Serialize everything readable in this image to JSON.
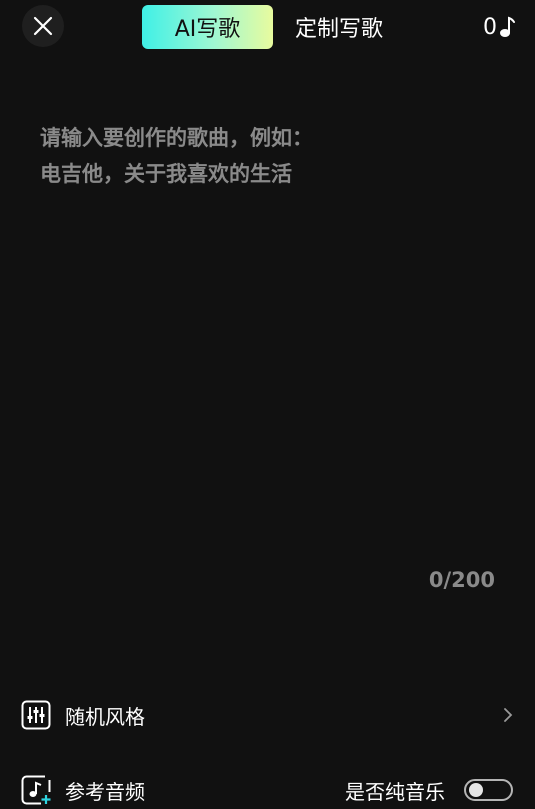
{
  "header": {
    "tab_ai": "AI写歌",
    "tab_custom": "定制写歌",
    "credits_count": "0"
  },
  "prompt": {
    "placeholder": "请输入要创作的歌曲，例如：\n电吉他，关于我喜欢的生活",
    "value": ""
  },
  "counter": "0/200",
  "style_row": {
    "label": "随机风格"
  },
  "reference_row": {
    "label": "参考音频",
    "pure_music_label": "是否纯音乐",
    "pure_music_on": false
  },
  "colors": {
    "background": "#111111",
    "accent_gradient": [
      "#3ff0e6",
      "#9ff7d2",
      "#e8fb9e"
    ],
    "muted_text": "#8a8a8a",
    "icon_accent": "#2fd4e0"
  }
}
